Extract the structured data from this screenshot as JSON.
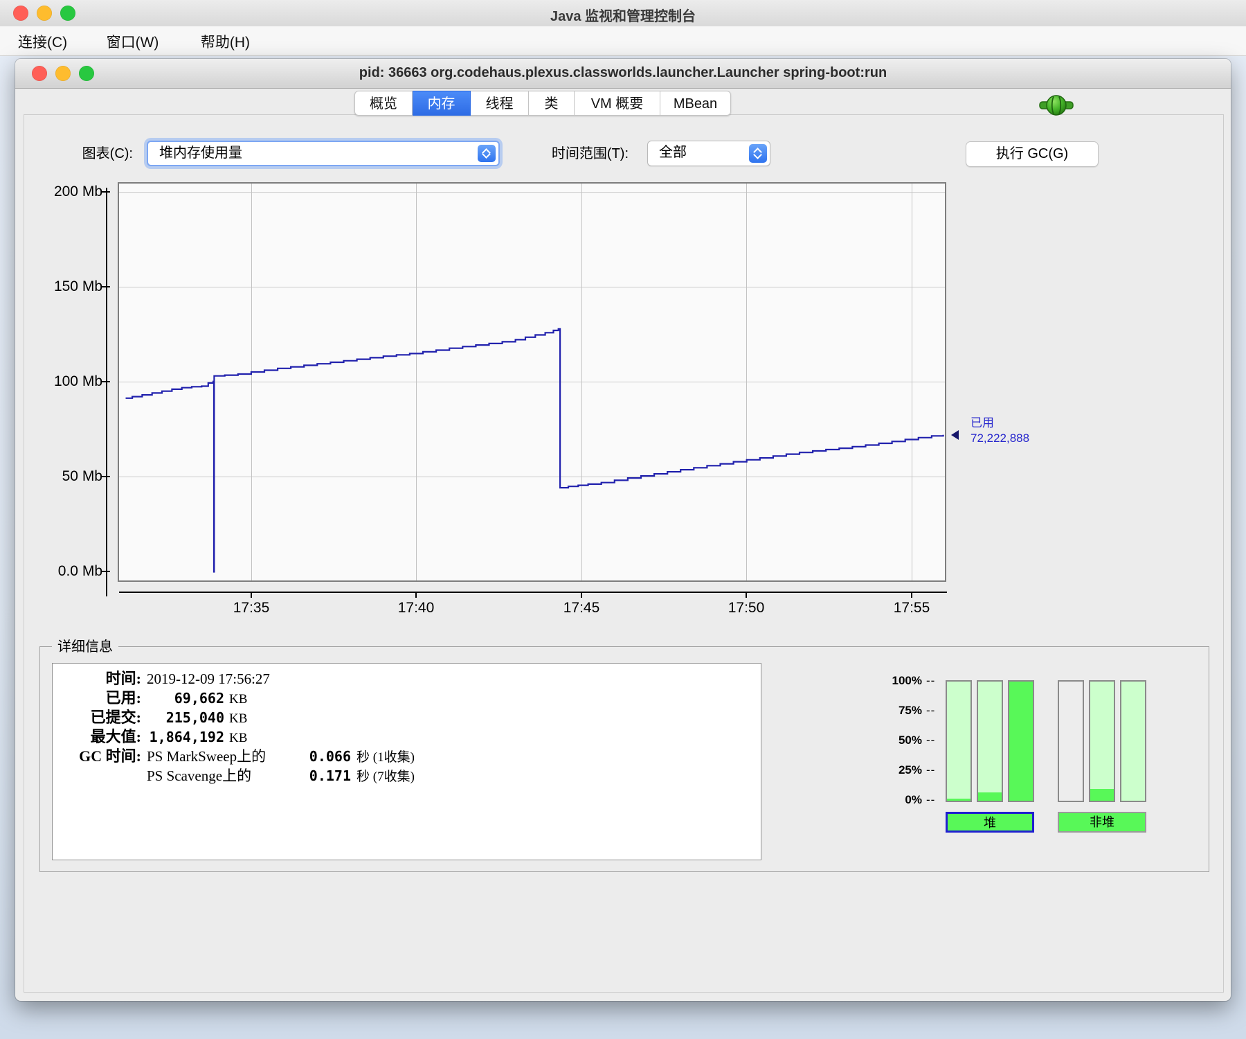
{
  "app": {
    "titlebar": {
      "title": "Java 监视和管理控制台"
    },
    "menubar": {
      "items": [
        {
          "label": "连接(C)"
        },
        {
          "label": "窗口(W)"
        },
        {
          "label": "帮助(H)"
        }
      ]
    }
  },
  "window": {
    "title": "pid: 36663 org.codehaus.plexus.classworlds.launcher.Launcher spring-boot:run",
    "tabs": [
      {
        "label": "概览",
        "selected": false
      },
      {
        "label": "内存",
        "selected": true
      },
      {
        "label": "线程",
        "selected": false
      },
      {
        "label": "类",
        "selected": false
      },
      {
        "label": "VM 概要",
        "selected": false
      },
      {
        "label": "MBean",
        "selected": false
      }
    ],
    "connection_icon": "green-plug"
  },
  "controls": {
    "chart_label": "图表(C):",
    "chart_select_value": "堆内存使用量",
    "range_label": "时间范围(T):",
    "range_select_value": "全部",
    "gc_button_label": "执行 GC(G)"
  },
  "chart_data": {
    "type": "line",
    "title": "堆内存使用量",
    "y_ticks": [
      "200 Mb",
      "150 Mb",
      "100 Mb",
      "50 Mb",
      "0.0 Mb"
    ],
    "ylim": [
      0,
      200
    ],
    "x_ticks": [
      "17:35",
      "17:40",
      "17:45",
      "17:50",
      "17:55"
    ],
    "x_domain_minutes_after_17h": [
      31,
      56
    ],
    "grid": true,
    "series": [
      {
        "name": "已用",
        "color": "#2121ad",
        "points_min_mb": [
          [
            31.2,
            91.5
          ],
          [
            31.4,
            92.3
          ],
          [
            31.7,
            93.2
          ],
          [
            32.0,
            94.2
          ],
          [
            32.3,
            95.2
          ],
          [
            32.6,
            96.2
          ],
          [
            32.9,
            97.0
          ],
          [
            33.2,
            97.5
          ],
          [
            33.5,
            97.8
          ],
          [
            33.7,
            99.5
          ],
          [
            33.85,
            100.3
          ],
          [
            33.87,
            0
          ],
          [
            33.88,
            103.2
          ],
          [
            34.2,
            103.6
          ],
          [
            34.6,
            104.2
          ],
          [
            35.0,
            105.3
          ],
          [
            35.4,
            106.2
          ],
          [
            35.8,
            107.2
          ],
          [
            36.2,
            108.0
          ],
          [
            36.6,
            108.8
          ],
          [
            37.0,
            109.6
          ],
          [
            37.4,
            110.4
          ],
          [
            37.8,
            111.2
          ],
          [
            38.2,
            112.0
          ],
          [
            38.6,
            112.8
          ],
          [
            39.0,
            113.6
          ],
          [
            39.4,
            114.3
          ],
          [
            39.8,
            115.0
          ],
          [
            40.2,
            115.9
          ],
          [
            40.6,
            116.8
          ],
          [
            41.0,
            117.8
          ],
          [
            41.4,
            118.7
          ],
          [
            41.8,
            119.5
          ],
          [
            42.2,
            120.3
          ],
          [
            42.6,
            121.2
          ],
          [
            43.0,
            122.3
          ],
          [
            43.3,
            123.6
          ],
          [
            43.6,
            124.8
          ],
          [
            43.9,
            126.0
          ],
          [
            44.15,
            127.2
          ],
          [
            44.3,
            128.0
          ],
          [
            44.35,
            44.3
          ],
          [
            44.6,
            45.0
          ],
          [
            44.9,
            45.6
          ],
          [
            45.2,
            46.2
          ],
          [
            45.6,
            47.0
          ],
          [
            46.0,
            48.2
          ],
          [
            46.4,
            49.4
          ],
          [
            46.8,
            50.5
          ],
          [
            47.2,
            51.6
          ],
          [
            47.6,
            52.7
          ],
          [
            48.0,
            53.8
          ],
          [
            48.4,
            54.8
          ],
          [
            48.8,
            55.9
          ],
          [
            49.2,
            56.9
          ],
          [
            49.6,
            58.0
          ],
          [
            50.0,
            59.0
          ],
          [
            50.4,
            60.0
          ],
          [
            50.8,
            61.0
          ],
          [
            51.2,
            62.0
          ],
          [
            51.6,
            62.9
          ],
          [
            52.0,
            63.7
          ],
          [
            52.4,
            64.4
          ],
          [
            52.8,
            65.1
          ],
          [
            53.2,
            65.9
          ],
          [
            53.6,
            66.8
          ],
          [
            54.0,
            67.7
          ],
          [
            54.4,
            68.7
          ],
          [
            54.8,
            69.7
          ],
          [
            55.2,
            70.7
          ],
          [
            55.6,
            71.6
          ],
          [
            55.95,
            72.2
          ]
        ]
      }
    ],
    "end_marker": {
      "label": "已用",
      "value_text": "72,222,888",
      "approx_mb": 72.2
    }
  },
  "details": {
    "legend": "详细信息",
    "rows": [
      {
        "label": "时间:",
        "value": "2019-12-09 17:56:27",
        "unit": ""
      },
      {
        "label": "已用:",
        "value": "69,662",
        "unit": "KB"
      },
      {
        "label": "已提交:",
        "value": "215,040",
        "unit": "KB"
      },
      {
        "label": "最大值:",
        "value": "1,864,192",
        "unit": "KB"
      }
    ],
    "gc_label": "GC 时间:",
    "gc_rows": [
      {
        "name": "PS MarkSweep上的",
        "time": "0.066",
        "unit": "秒 (1收集)"
      },
      {
        "name": "PS Scavenge上的",
        "time": "0.171",
        "unit": "秒 (7收集)"
      }
    ]
  },
  "pools": {
    "ticks": [
      {
        "label": "100%"
      },
      {
        "label": "75%"
      },
      {
        "label": "50%"
      },
      {
        "label": "25%"
      },
      {
        "label": "0%"
      }
    ],
    "tick_dash": "--",
    "bars": [
      {
        "name": "heap-bar-1",
        "used_pct": 2,
        "capacity_full": true
      },
      {
        "name": "heap-bar-2",
        "used_pct": 7,
        "capacity_full": true
      },
      {
        "name": "heap-bar-3",
        "used_pct": 100,
        "capacity_full": true
      },
      {
        "name": "nonheap-bar-1",
        "used_pct": 0,
        "capacity_full": false
      },
      {
        "name": "nonheap-bar-2",
        "used_pct": 10,
        "capacity_full": true
      },
      {
        "name": "nonheap-bar-3",
        "used_pct": 0,
        "capacity_full": true
      }
    ],
    "buttons": [
      {
        "label": "堆",
        "selected": true
      },
      {
        "label": "非堆",
        "selected": false
      }
    ],
    "colors": {
      "used": "#58f858",
      "capacity": "#ccffcc",
      "empty": "#ededed"
    }
  },
  "colors": {
    "series_line": "#2121ad",
    "marker_text": "#2727cd",
    "tab_selected_top": "#4b8bf8",
    "tab_selected_bottom": "#2e6ce5",
    "traffic_red": "#ff5f57",
    "traffic_yellow": "#febc2e",
    "traffic_green": "#28c840"
  }
}
